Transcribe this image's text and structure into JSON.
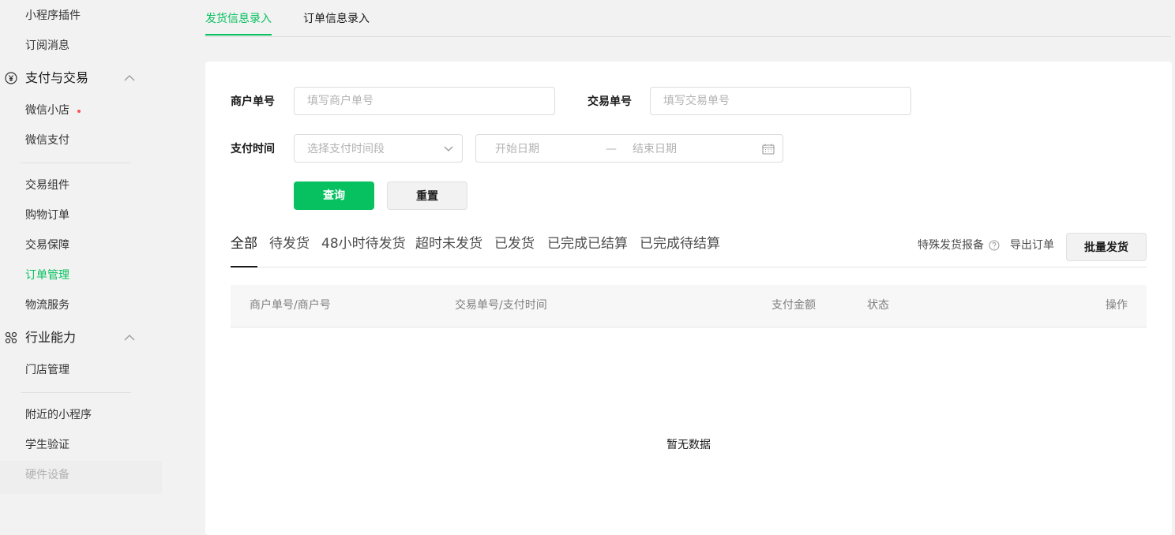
{
  "sidebar": {
    "items_top": [
      {
        "label": "小程序插件"
      },
      {
        "label": "订阅消息"
      }
    ],
    "group_payment": {
      "label": "支付与交易",
      "icon": "yuan-circle-icon"
    },
    "payment_items": [
      {
        "label": "微信小店"
      },
      {
        "label": "微信支付"
      }
    ],
    "trade_items": [
      {
        "label": "交易组件"
      },
      {
        "label": "购物订单"
      },
      {
        "label": "交易保障"
      },
      {
        "label": "订单管理"
      },
      {
        "label": "物流服务"
      }
    ],
    "group_industry": {
      "label": "行业能力",
      "icon": "industry-nodes-icon"
    },
    "industry_items": [
      {
        "label": "门店管理"
      }
    ],
    "other_items": [
      {
        "label": "附近的小程序"
      },
      {
        "label": "学生验证"
      },
      {
        "label": "硬件设备"
      }
    ],
    "active_item": "订单管理",
    "accent_color": "#07c160"
  },
  "top_tabs": [
    {
      "label": "发货信息录入"
    },
    {
      "label": "订单信息录入"
    }
  ],
  "form": {
    "merchant_no": {
      "label": "商户单号",
      "placeholder": "填写商户单号",
      "value": ""
    },
    "transaction_no": {
      "label": "交易单号",
      "placeholder": "填写交易单号",
      "value": ""
    },
    "pay_time": {
      "label": "支付时间",
      "select_placeholder": "选择支付时间段",
      "start_placeholder": "开始日期",
      "separator": "—",
      "end_placeholder": "结束日期"
    },
    "query_button": "查询",
    "reset_button": "重置"
  },
  "status_tabs": [
    {
      "label": "全部"
    },
    {
      "label": "待发货"
    },
    {
      "label": "48小时待发货"
    },
    {
      "label": "超时未发货"
    },
    {
      "label": "已发货"
    },
    {
      "label": "已完成已结算"
    },
    {
      "label": "已完成待结算"
    }
  ],
  "actions": {
    "special_report": "特殊发货报备",
    "export": "导出订单",
    "batch_ship": "批量发货"
  },
  "table": {
    "columns": [
      "商户单号/商户号",
      "交易单号/支付时间",
      "支付金额",
      "状态",
      "操作"
    ],
    "rows": [],
    "empty_text": "暂无数据"
  },
  "colors": {
    "primary": "#07c160",
    "badge_dot": "#fa5151"
  }
}
